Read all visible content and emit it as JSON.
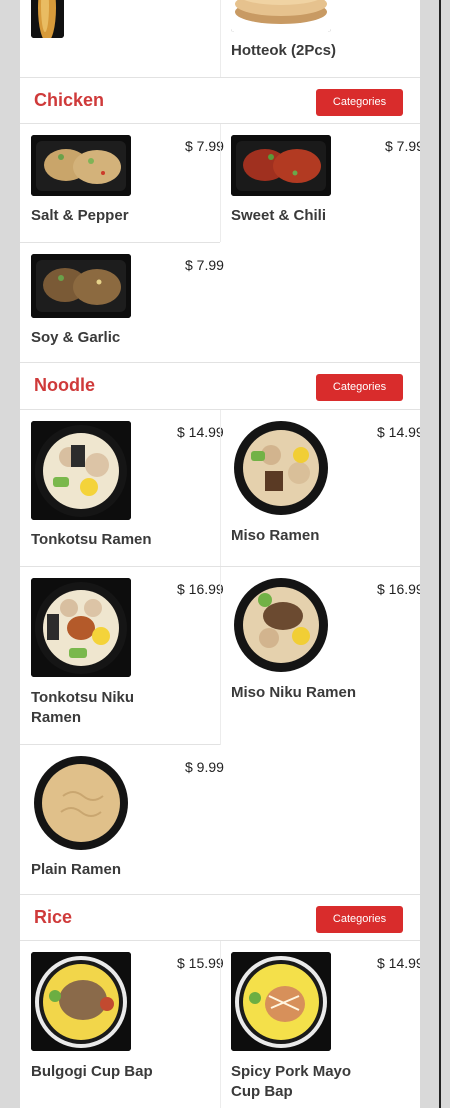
{
  "colors": {
    "accent": "#d92c2c",
    "section_title": "#cf3a3a",
    "divider": "#e2e2e2"
  },
  "top": {
    "item_name": "Hotteok (2Pcs)"
  },
  "sections": [
    {
      "title": "Chicken",
      "button_label": "Categories",
      "items": [
        {
          "name": "Salt & Pepper",
          "price": "$ 7.99"
        },
        {
          "name": "Sweet & Chili",
          "price": "$ 7.99"
        },
        {
          "name": "Soy & Garlic",
          "price": "$ 7.99"
        }
      ]
    },
    {
      "title": "Noodle",
      "button_label": "Categories",
      "items": [
        {
          "name": "Tonkotsu Ramen",
          "price": "$ 14.99"
        },
        {
          "name": "Miso Ramen",
          "price": "$ 14.99"
        },
        {
          "name": "Tonkotsu Niku Ramen",
          "price": "$ 16.99"
        },
        {
          "name": "Miso Niku Ramen",
          "price": "$ 16.99"
        },
        {
          "name": "Plain Ramen",
          "price": "$ 9.99"
        }
      ]
    },
    {
      "title": "Rice",
      "button_label": "Categories",
      "items": [
        {
          "name": "Bulgogi Cup Bap",
          "price": "$ 15.99"
        },
        {
          "name": "Spicy Pork Mayo Cup Bap",
          "price": "$ 14.99"
        }
      ]
    }
  ]
}
